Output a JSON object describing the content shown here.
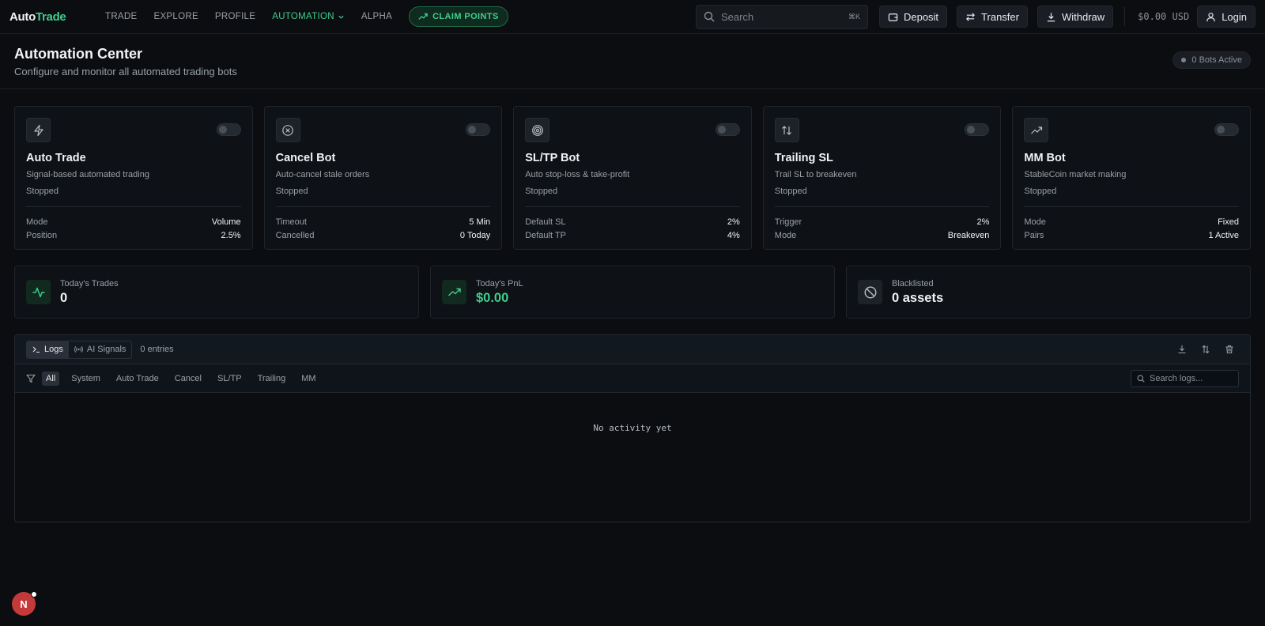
{
  "brand": {
    "part1": "Auto",
    "part2": "Trade"
  },
  "nav": {
    "items": [
      {
        "label": "TRADE"
      },
      {
        "label": "EXPLORE"
      },
      {
        "label": "PROFILE"
      },
      {
        "label": "AUTOMATION"
      },
      {
        "label": "ALPHA"
      }
    ],
    "claim_label": "CLAIM POINTS",
    "search_placeholder": "Search",
    "search_shortcut": "⌘K",
    "deposit": "Deposit",
    "transfer": "Transfer",
    "withdraw": "Withdraw",
    "balance": "$0.00 USD",
    "login": "Login"
  },
  "header": {
    "title": "Automation Center",
    "subtitle": "Configure and monitor all automated trading bots",
    "bots_active": "0 Bots Active"
  },
  "bots": [
    {
      "name": "Auto Trade",
      "desc": "Signal-based automated trading",
      "status": "Stopped",
      "icon": "lightning-icon",
      "rows": [
        {
          "k": "Mode",
          "v": "Volume"
        },
        {
          "k": "Position",
          "v": "2.5%"
        }
      ]
    },
    {
      "name": "Cancel Bot",
      "desc": "Auto-cancel stale orders",
      "status": "Stopped",
      "icon": "cancel-circle-icon",
      "rows": [
        {
          "k": "Timeout",
          "v": "5 Min"
        },
        {
          "k": "Cancelled",
          "v": "0 Today"
        }
      ]
    },
    {
      "name": "SL/TP Bot",
      "desc": "Auto stop-loss & take-profit",
      "status": "Stopped",
      "icon": "target-icon",
      "rows": [
        {
          "k": "Default SL",
          "v": "2%"
        },
        {
          "k": "Default TP",
          "v": "4%"
        }
      ]
    },
    {
      "name": "Trailing SL",
      "desc": "Trail SL to breakeven",
      "status": "Stopped",
      "icon": "up-down-arrows-icon",
      "rows": [
        {
          "k": "Trigger",
          "v": "2%"
        },
        {
          "k": "Mode",
          "v": "Breakeven"
        }
      ]
    },
    {
      "name": "MM Bot",
      "desc": "StableCoin market making",
      "status": "Stopped",
      "icon": "trending-up-icon",
      "rows": [
        {
          "k": "Mode",
          "v": "Fixed"
        },
        {
          "k": "Pairs",
          "v": "1 Active"
        }
      ]
    }
  ],
  "stats": [
    {
      "label": "Today's Trades",
      "value": "0"
    },
    {
      "label": "Today's PnL",
      "value": "$0.00"
    },
    {
      "label": "Blacklisted",
      "value": "0 assets"
    }
  ],
  "logs": {
    "tabs": [
      {
        "label": "Logs"
      },
      {
        "label": "AI Signals"
      }
    ],
    "entries": "0 entries",
    "filters": [
      "All",
      "System",
      "Auto Trade",
      "Cancel",
      "SL/TP",
      "Trailing",
      "MM"
    ],
    "search_placeholder": "Search logs...",
    "empty": "No activity yet"
  },
  "fab_letter": "N",
  "colors": {
    "accent": "#3ecf8e",
    "background": "#0b0d10",
    "card": "#0e1115",
    "danger": "#c43a3a"
  }
}
